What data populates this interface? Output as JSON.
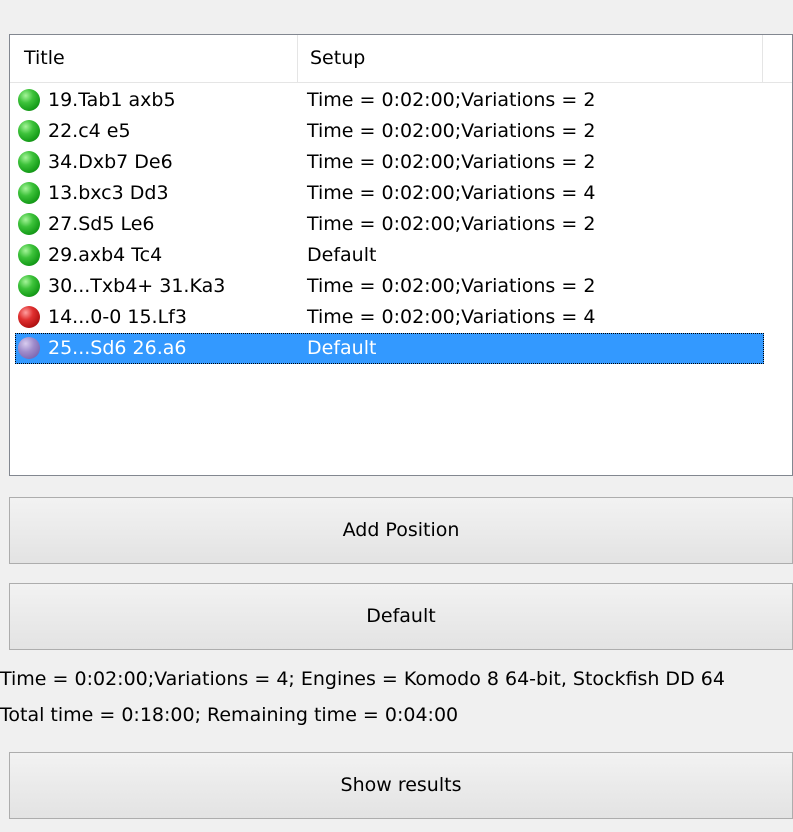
{
  "list": {
    "columns": {
      "title": "Title",
      "setup": "Setup"
    },
    "rows": [
      {
        "status": "green",
        "title": "19.Tab1 axb5",
        "setup": "Time = 0:02:00;Variations = 2"
      },
      {
        "status": "green",
        "title": "22.c4 e5",
        "setup": "Time = 0:02:00;Variations = 2"
      },
      {
        "status": "green",
        "title": "34.Dxb7 De6",
        "setup": "Time = 0:02:00;Variations = 2"
      },
      {
        "status": "green",
        "title": "13.bxc3 Dd3",
        "setup": "Time = 0:02:00;Variations = 4"
      },
      {
        "status": "green",
        "title": "27.Sd5 Le6",
        "setup": "Time = 0:02:00;Variations = 2"
      },
      {
        "status": "green",
        "title": "29.axb4 Tc4",
        "setup": "Default"
      },
      {
        "status": "green",
        "title": "30...Txb4+ 31.Ka3",
        "setup": "Time = 0:02:00;Variations = 2"
      },
      {
        "status": "red",
        "title": "14...0-0 15.Lf3",
        "setup": "Time = 0:02:00;Variations = 4"
      },
      {
        "status": "purple",
        "title": "25...Sd6 26.a6",
        "setup": "Default",
        "selected": true
      }
    ]
  },
  "buttons": {
    "add_position": "Add Position",
    "default": "Default",
    "show_results": "Show results"
  },
  "info": {
    "line1": "Time = 0:02:00;Variations = 4; Engines = Komodo 8 64-bit, Stockfish DD 64",
    "line2": "Total time = 0:18:00; Remaining time = 0:04:00"
  },
  "colors": {
    "selection": "#3399ff",
    "status_green": "#2fb52c",
    "status_red": "#cc1f1f",
    "status_purple": "#8e7bc0"
  }
}
